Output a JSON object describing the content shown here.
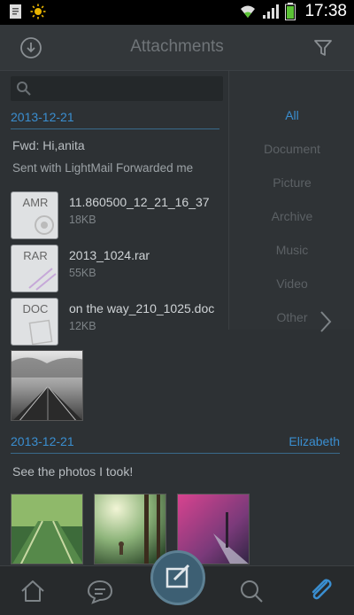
{
  "status_bar": {
    "time": "17:38"
  },
  "header": {
    "title": "Attachments"
  },
  "filter": {
    "items": [
      "All",
      "Document",
      "Picture",
      "Archive",
      "Music",
      "Video",
      "Other"
    ],
    "active": "All"
  },
  "groups": [
    {
      "date": "2013-12-21",
      "subject": "Fwd: Hi,anita",
      "preview": "Sent with LightMail Forwarded me",
      "attachments": [
        {
          "type": "AMR",
          "name": "11.860500_12_21_16_37",
          "size": "18KB"
        },
        {
          "type": "RAR",
          "name": "2013_1024.rar",
          "size": "55KB"
        },
        {
          "type": "DOC",
          "name": "on the way_210_1025.doc",
          "size": "12KB"
        }
      ]
    },
    {
      "date": "2013-12-21",
      "sender": "Elizabeth",
      "subject": "See the photos I took!"
    }
  ],
  "colors": {
    "accent": "#3a8ed0",
    "background": "#2d3134"
  },
  "icons": {
    "header_left": "download-circle-icon",
    "header_right": "filter-icon",
    "nav": [
      "home-icon",
      "chat-icon",
      "compose-icon",
      "search-icon",
      "attachment-icon"
    ]
  }
}
